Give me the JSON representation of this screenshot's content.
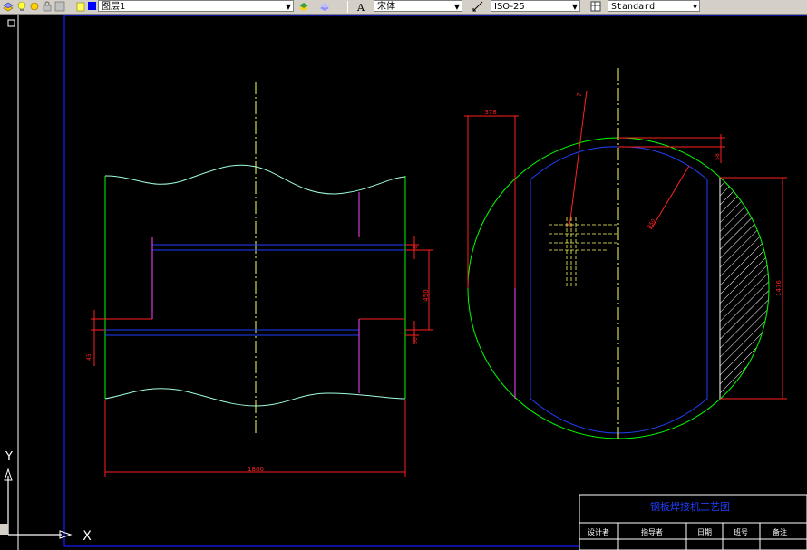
{
  "toolbar": {
    "layer_value": "图层1",
    "font_value": "宋体",
    "dimstyle_value": "ISO-25",
    "tablestyle_value": "Standard"
  },
  "dimensions": {
    "d1800": "1800",
    "d450": "450",
    "d8": "8",
    "d45": "45",
    "d50": "50",
    "d378": "378",
    "d58": "58",
    "d1476": "1476",
    "d7": "7",
    "d850": "850"
  },
  "title_block": {
    "title": "钢板焊接机工艺图",
    "col1": "设计者",
    "col2": "指导者",
    "col3": "日期",
    "col4": "班号",
    "col5": "备注"
  },
  "ucs": {
    "y_label": "Y",
    "x_label": "X"
  },
  "colors": {
    "background": "#000000",
    "border": "#1a1aff",
    "outline_green": "#00ff00",
    "wave_cyan": "#a0ffe0",
    "dimension_red": "#ff2020",
    "center_yellow": "#ffff60",
    "magenta": "#ff40ff",
    "blue_line": "#2040ff"
  }
}
